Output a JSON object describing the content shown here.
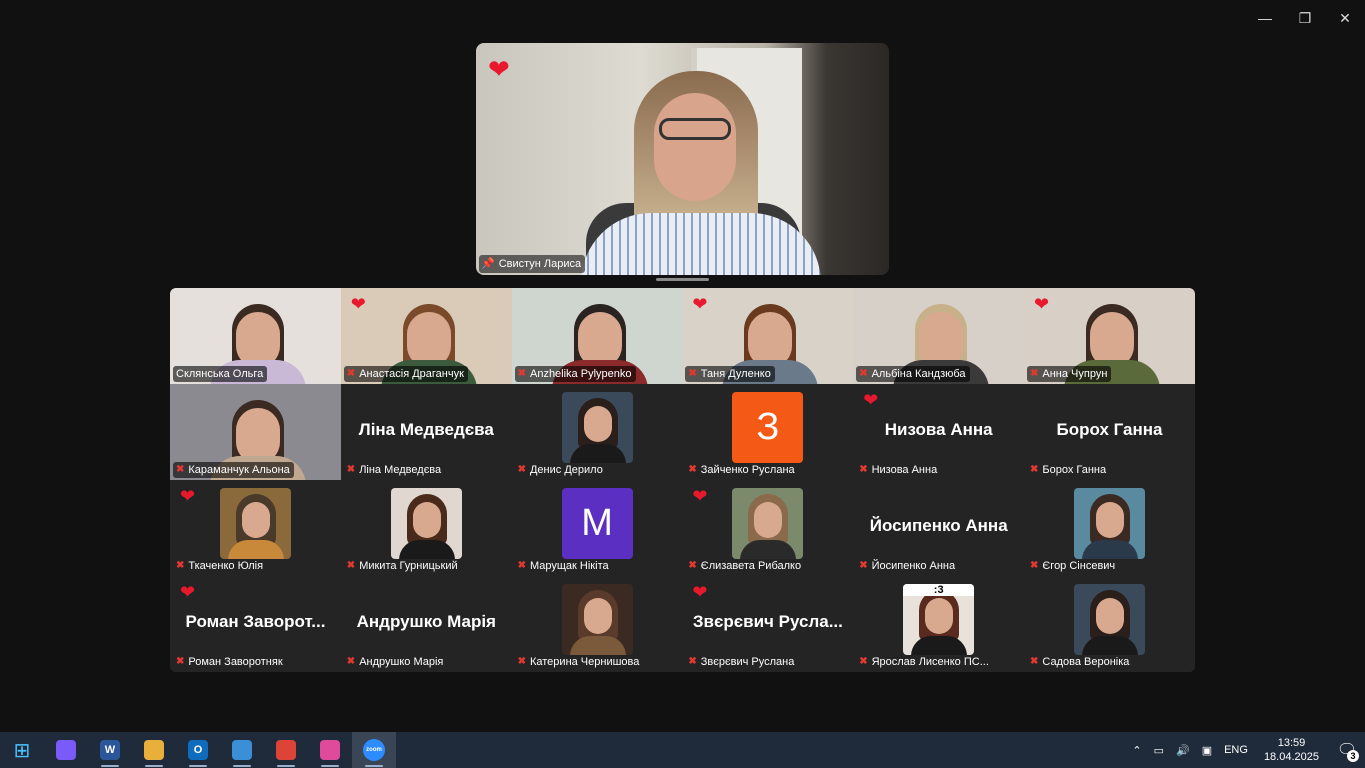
{
  "window": {
    "minimize_icon": "minimize-icon",
    "restore_icon": "restore-icon",
    "close_icon": "close-icon"
  },
  "speaker": {
    "name": "Свистун Лариса",
    "reaction": "heart"
  },
  "participants": [
    {
      "name": "Склянська Ольга",
      "display": "video",
      "muted": false,
      "reaction": false
    },
    {
      "name": "Анастасія Драганчук",
      "display": "video",
      "muted": true,
      "reaction": true
    },
    {
      "name": "Anzhelika Pylypenko",
      "display": "video",
      "muted": true,
      "reaction": false
    },
    {
      "name": "Таня Дуленко",
      "display": "video",
      "muted": true,
      "reaction": true
    },
    {
      "name": "Альбіна Кандзюба",
      "display": "video",
      "muted": true,
      "reaction": false
    },
    {
      "name": "Анна Чупрун",
      "display": "video",
      "muted": true,
      "reaction": true
    },
    {
      "name": "Караманчук Альона",
      "display": "video",
      "muted": true,
      "reaction": false
    },
    {
      "name": "Ліна Медведєва",
      "display": "name",
      "big": "Ліна Медведєва",
      "muted": true,
      "reaction": false
    },
    {
      "name": "Денис Дерило",
      "display": "avatar",
      "muted": true,
      "reaction": false
    },
    {
      "name": "Зайченко Руслана",
      "display": "letter",
      "letter": "З",
      "color": "#f45a15",
      "muted": true,
      "reaction": false
    },
    {
      "name": "Низова Анна",
      "display": "name",
      "big": "Низова Анна",
      "muted": true,
      "reaction": true
    },
    {
      "name": "Борох Ганна",
      "display": "name",
      "big": "Борох Ганна",
      "muted": true,
      "reaction": false
    },
    {
      "name": "Ткаченко Юлія",
      "display": "avatar",
      "muted": true,
      "reaction": true
    },
    {
      "name": "Микита Гурницький",
      "display": "avatar",
      "muted": true,
      "reaction": false
    },
    {
      "name": "Марущак Нікіта",
      "display": "letter",
      "letter": "M",
      "color": "#5b2fc2",
      "muted": true,
      "reaction": false
    },
    {
      "name": "Єлизавета Рибалко",
      "display": "avatar",
      "muted": true,
      "reaction": true
    },
    {
      "name": "Йосипенко Анна",
      "display": "name",
      "big": "Йосипенко Анна",
      "muted": true,
      "reaction": false
    },
    {
      "name": "Єгор Сінсевич",
      "display": "avatar",
      "muted": true,
      "reaction": false
    },
    {
      "name": "Роман Заворотняк",
      "display": "name",
      "big": "Роман Заворот...",
      "muted": true,
      "reaction": true
    },
    {
      "name": "Андрушко Марія",
      "display": "name",
      "big": "Андрушко Марія",
      "muted": true,
      "reaction": false
    },
    {
      "name": "Катерина Чернишова",
      "display": "avatar",
      "muted": true,
      "reaction": false
    },
    {
      "name": "Звєрєвич Руслана",
      "display": "name",
      "big": "Звєрєвич Русла...",
      "muted": true,
      "reaction": true
    },
    {
      "name": "Ярослав Лисенко ПС...",
      "display": "avatar",
      "avatar_text": ":3",
      "muted": true,
      "reaction": false
    },
    {
      "name": "Садова Вероніка",
      "display": "avatar",
      "muted": true,
      "reaction": false
    }
  ],
  "taskbar": {
    "apps": [
      {
        "name": "start-icon",
        "glyph": "⊞",
        "color": "#1f2a3a"
      },
      {
        "name": "copilot-icon",
        "glyph": "",
        "color": "#7a5af8"
      },
      {
        "name": "word-icon",
        "glyph": "W",
        "color": "#2b579a"
      },
      {
        "name": "file-explorer-icon",
        "glyph": "",
        "color": "#e8b03a"
      },
      {
        "name": "outlook-icon",
        "glyph": "O",
        "color": "#0f6cbd"
      },
      {
        "name": "control-panel-icon",
        "glyph": "",
        "color": "#3a8fd6"
      },
      {
        "name": "chrome-icon",
        "glyph": "",
        "color": "#db4437"
      },
      {
        "name": "paint-icon",
        "glyph": "",
        "color": "#e04a9a"
      },
      {
        "name": "zoom-icon",
        "glyph": "zoom",
        "color": "#2d8cff"
      }
    ],
    "language": "ENG",
    "time": "13:59",
    "date": "18.04.2025",
    "notifications": "3"
  }
}
